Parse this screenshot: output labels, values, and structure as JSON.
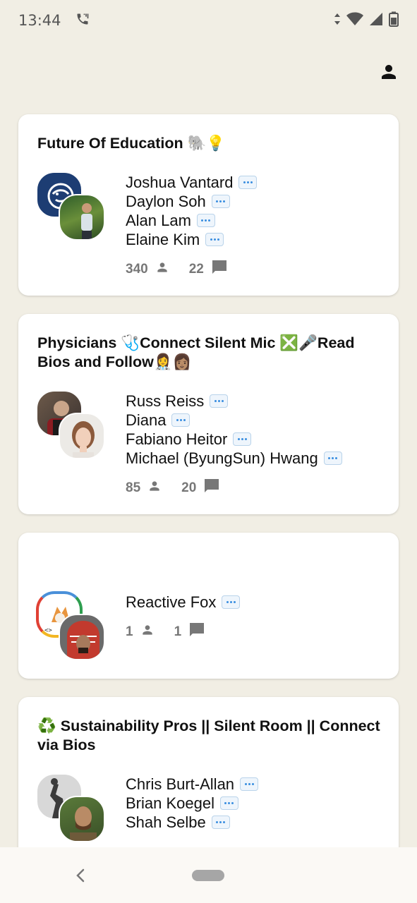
{
  "status_bar": {
    "time": "13:44"
  },
  "rooms": [
    {
      "title": "Future Of Education 🐘💡",
      "speakers": [
        "Joshua Vantard",
        "Daylon Soh",
        "Alan Lam",
        "Elaine Kim"
      ],
      "listeners": "340",
      "comments": "22"
    },
    {
      "title": "Physicians 🩺Connect Silent Mic ❎🎤Read Bios and Follow👩‍⚕️👩🏽",
      "speakers": [
        "Russ Reiss",
        "Diana",
        "Fabiano Heitor",
        "Michael (ByungSun) Hwang"
      ],
      "listeners": "85",
      "comments": "20"
    },
    {
      "title": "",
      "speakers": [
        "Reactive Fox"
      ],
      "listeners": "1",
      "comments": "1"
    },
    {
      "title": "♻️ Sustainability Pros || Silent Room || Connect via Bios",
      "speakers": [
        "Chris Burt-Allan",
        "Brian Koegel",
        "Shah Selbe"
      ],
      "listeners": "",
      "comments": ""
    }
  ],
  "colors": {
    "background": "#f1eee4",
    "card": "#ffffff",
    "bubble": "#3a8ee0"
  }
}
